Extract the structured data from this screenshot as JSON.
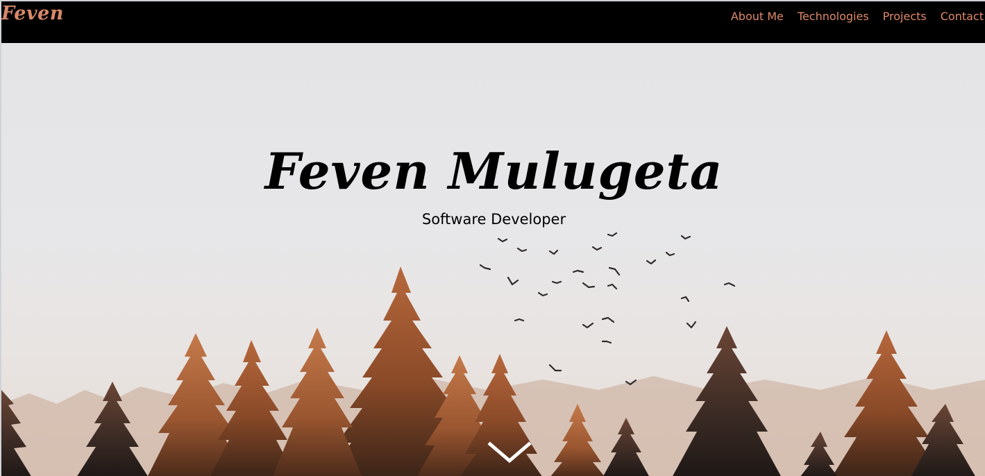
{
  "navbar": {
    "brand": "Feven",
    "links": [
      {
        "label": "About Me",
        "icon": null
      },
      {
        "label": "Technologies"
      },
      {
        "label": "Projects"
      },
      {
        "label": "Contact"
      }
    ]
  },
  "hero": {
    "title": "Feven Mulugeta",
    "subtitle": "Software Developer",
    "scroll_icon": "chevron-down-icon"
  },
  "colors": {
    "accent": "#e08a67",
    "navbar_bg": "#000000",
    "text": "#000000"
  }
}
